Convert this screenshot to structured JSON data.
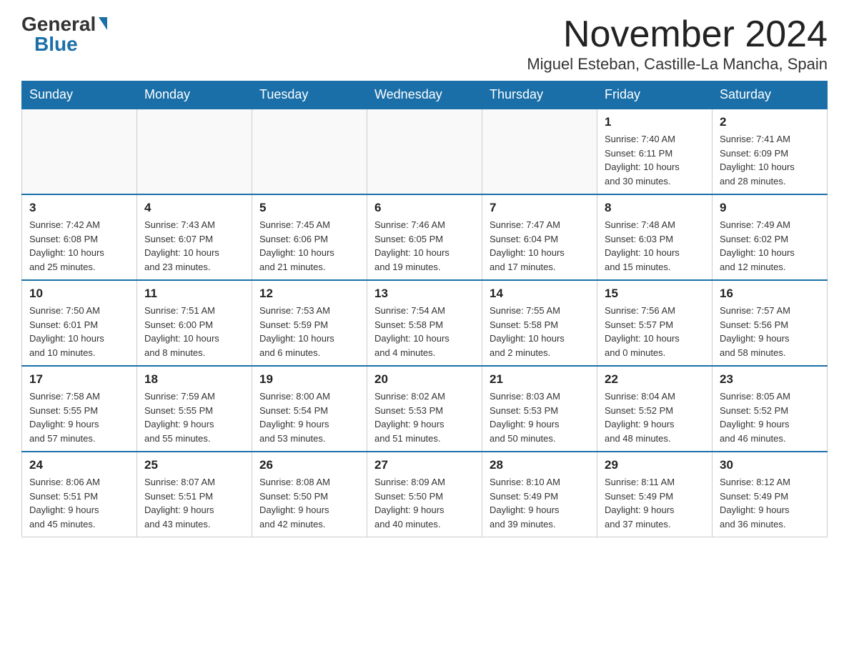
{
  "logo": {
    "general": "General",
    "blue": "Blue"
  },
  "title": "November 2024",
  "subtitle": "Miguel Esteban, Castille-La Mancha, Spain",
  "days_of_week": [
    "Sunday",
    "Monday",
    "Tuesday",
    "Wednesday",
    "Thursday",
    "Friday",
    "Saturday"
  ],
  "weeks": [
    [
      {
        "day": "",
        "info": ""
      },
      {
        "day": "",
        "info": ""
      },
      {
        "day": "",
        "info": ""
      },
      {
        "day": "",
        "info": ""
      },
      {
        "day": "",
        "info": ""
      },
      {
        "day": "1",
        "info": "Sunrise: 7:40 AM\nSunset: 6:11 PM\nDaylight: 10 hours\nand 30 minutes."
      },
      {
        "day": "2",
        "info": "Sunrise: 7:41 AM\nSunset: 6:09 PM\nDaylight: 10 hours\nand 28 minutes."
      }
    ],
    [
      {
        "day": "3",
        "info": "Sunrise: 7:42 AM\nSunset: 6:08 PM\nDaylight: 10 hours\nand 25 minutes."
      },
      {
        "day": "4",
        "info": "Sunrise: 7:43 AM\nSunset: 6:07 PM\nDaylight: 10 hours\nand 23 minutes."
      },
      {
        "day": "5",
        "info": "Sunrise: 7:45 AM\nSunset: 6:06 PM\nDaylight: 10 hours\nand 21 minutes."
      },
      {
        "day": "6",
        "info": "Sunrise: 7:46 AM\nSunset: 6:05 PM\nDaylight: 10 hours\nand 19 minutes."
      },
      {
        "day": "7",
        "info": "Sunrise: 7:47 AM\nSunset: 6:04 PM\nDaylight: 10 hours\nand 17 minutes."
      },
      {
        "day": "8",
        "info": "Sunrise: 7:48 AM\nSunset: 6:03 PM\nDaylight: 10 hours\nand 15 minutes."
      },
      {
        "day": "9",
        "info": "Sunrise: 7:49 AM\nSunset: 6:02 PM\nDaylight: 10 hours\nand 12 minutes."
      }
    ],
    [
      {
        "day": "10",
        "info": "Sunrise: 7:50 AM\nSunset: 6:01 PM\nDaylight: 10 hours\nand 10 minutes."
      },
      {
        "day": "11",
        "info": "Sunrise: 7:51 AM\nSunset: 6:00 PM\nDaylight: 10 hours\nand 8 minutes."
      },
      {
        "day": "12",
        "info": "Sunrise: 7:53 AM\nSunset: 5:59 PM\nDaylight: 10 hours\nand 6 minutes."
      },
      {
        "day": "13",
        "info": "Sunrise: 7:54 AM\nSunset: 5:58 PM\nDaylight: 10 hours\nand 4 minutes."
      },
      {
        "day": "14",
        "info": "Sunrise: 7:55 AM\nSunset: 5:58 PM\nDaylight: 10 hours\nand 2 minutes."
      },
      {
        "day": "15",
        "info": "Sunrise: 7:56 AM\nSunset: 5:57 PM\nDaylight: 10 hours\nand 0 minutes."
      },
      {
        "day": "16",
        "info": "Sunrise: 7:57 AM\nSunset: 5:56 PM\nDaylight: 9 hours\nand 58 minutes."
      }
    ],
    [
      {
        "day": "17",
        "info": "Sunrise: 7:58 AM\nSunset: 5:55 PM\nDaylight: 9 hours\nand 57 minutes."
      },
      {
        "day": "18",
        "info": "Sunrise: 7:59 AM\nSunset: 5:55 PM\nDaylight: 9 hours\nand 55 minutes."
      },
      {
        "day": "19",
        "info": "Sunrise: 8:00 AM\nSunset: 5:54 PM\nDaylight: 9 hours\nand 53 minutes."
      },
      {
        "day": "20",
        "info": "Sunrise: 8:02 AM\nSunset: 5:53 PM\nDaylight: 9 hours\nand 51 minutes."
      },
      {
        "day": "21",
        "info": "Sunrise: 8:03 AM\nSunset: 5:53 PM\nDaylight: 9 hours\nand 50 minutes."
      },
      {
        "day": "22",
        "info": "Sunrise: 8:04 AM\nSunset: 5:52 PM\nDaylight: 9 hours\nand 48 minutes."
      },
      {
        "day": "23",
        "info": "Sunrise: 8:05 AM\nSunset: 5:52 PM\nDaylight: 9 hours\nand 46 minutes."
      }
    ],
    [
      {
        "day": "24",
        "info": "Sunrise: 8:06 AM\nSunset: 5:51 PM\nDaylight: 9 hours\nand 45 minutes."
      },
      {
        "day": "25",
        "info": "Sunrise: 8:07 AM\nSunset: 5:51 PM\nDaylight: 9 hours\nand 43 minutes."
      },
      {
        "day": "26",
        "info": "Sunrise: 8:08 AM\nSunset: 5:50 PM\nDaylight: 9 hours\nand 42 minutes."
      },
      {
        "day": "27",
        "info": "Sunrise: 8:09 AM\nSunset: 5:50 PM\nDaylight: 9 hours\nand 40 minutes."
      },
      {
        "day": "28",
        "info": "Sunrise: 8:10 AM\nSunset: 5:49 PM\nDaylight: 9 hours\nand 39 minutes."
      },
      {
        "day": "29",
        "info": "Sunrise: 8:11 AM\nSunset: 5:49 PM\nDaylight: 9 hours\nand 37 minutes."
      },
      {
        "day": "30",
        "info": "Sunrise: 8:12 AM\nSunset: 5:49 PM\nDaylight: 9 hours\nand 36 minutes."
      }
    ]
  ]
}
